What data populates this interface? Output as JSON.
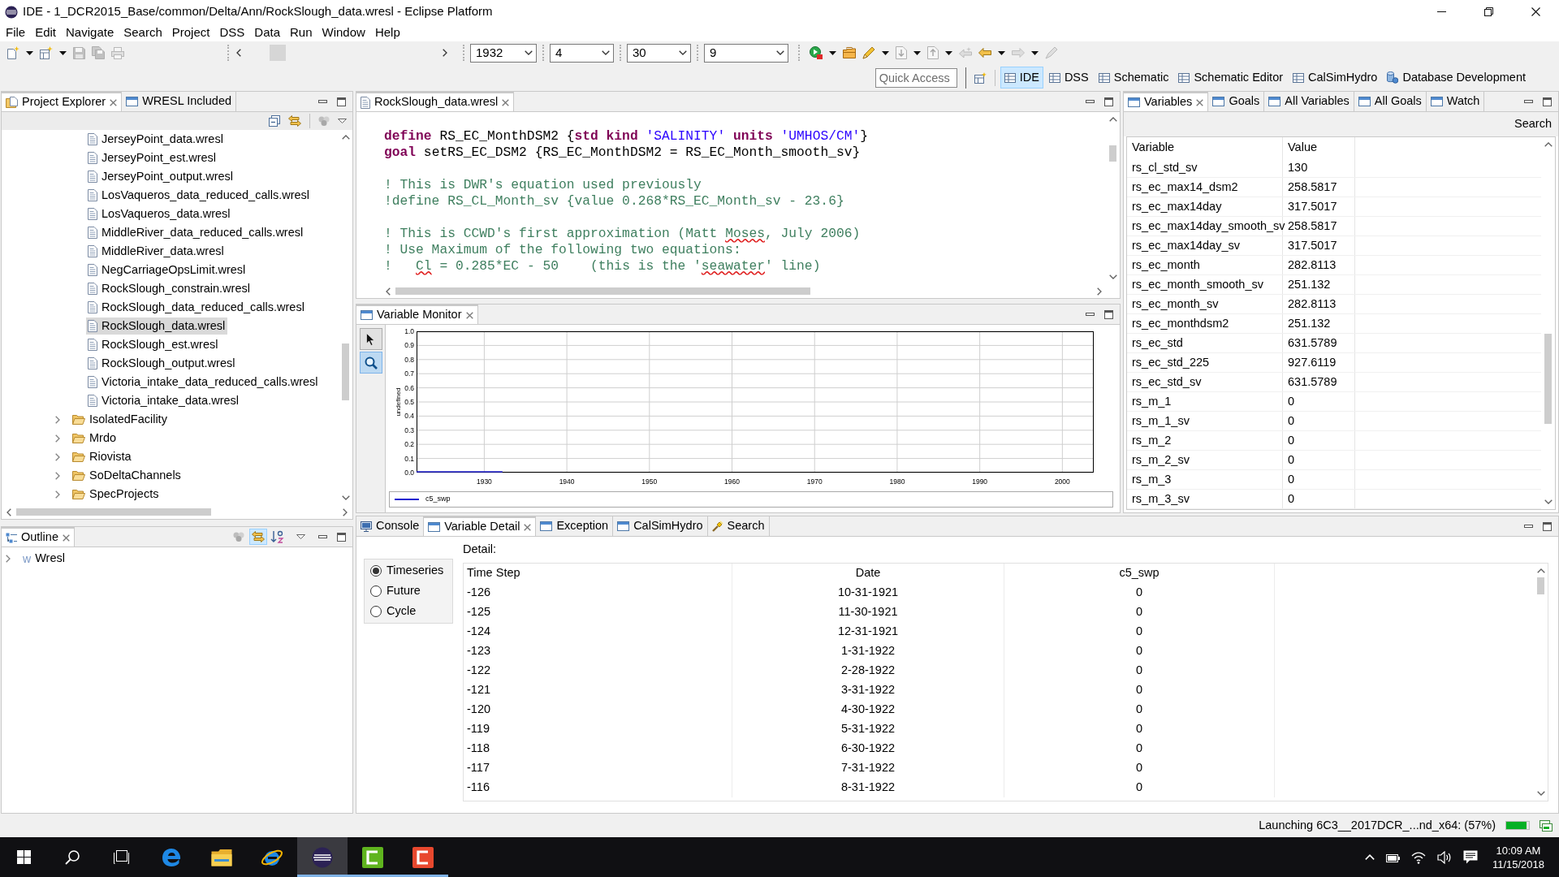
{
  "window": {
    "title": "IDE - 1_DCR2015_Base/common/Delta/Ann/RockSlough_data.wresl - Eclipse Platform"
  },
  "menu": [
    "File",
    "Edit",
    "Navigate",
    "Search",
    "Project",
    "DSS",
    "Data",
    "Run",
    "Window",
    "Help"
  ],
  "toolbar": {
    "tools_left": [
      {
        "kind": "new",
        "dropdown": true,
        "disabled": false
      },
      {
        "kind": "new-window",
        "dropdown": true,
        "disabled": false
      },
      {
        "kind": "save",
        "disabled": true
      },
      {
        "kind": "save-all",
        "disabled": true
      },
      {
        "kind": "print",
        "disabled": true
      }
    ],
    "combos": [
      {
        "value": "1932"
      },
      {
        "value": "4"
      },
      {
        "value": "30"
      },
      {
        "value": "9"
      }
    ],
    "tools_right": [
      {
        "kind": "run",
        "dropdown": true,
        "disabled": false
      },
      {
        "kind": "open",
        "disabled": false
      },
      {
        "kind": "pencil",
        "dropdown": true,
        "disabled": false
      },
      {
        "kind": "annotation-next",
        "dropdown": true,
        "disabled": true
      },
      {
        "kind": "annotation-prev",
        "dropdown": true,
        "disabled": true
      },
      {
        "kind": "last-edit",
        "disabled": true
      },
      {
        "kind": "back",
        "dropdown": true,
        "disabled": false
      },
      {
        "kind": "forward",
        "dropdown": true,
        "disabled": true
      },
      {
        "kind": "pen",
        "disabled": true
      }
    ],
    "quick_access": {
      "placeholder": "Quick Access"
    },
    "perspectives": [
      {
        "label": "IDE",
        "kind": "standard",
        "selected": true
      },
      {
        "label": "DSS",
        "kind": "standard",
        "selected": false
      },
      {
        "label": "Schematic",
        "kind": "standard",
        "selected": false
      },
      {
        "label": "Schematic Editor",
        "kind": "standard",
        "selected": false
      },
      {
        "label": "CalSimHydro",
        "kind": "standard",
        "selected": false
      },
      {
        "label": "Database Development",
        "kind": "database",
        "selected": false
      }
    ]
  },
  "project_explorer": {
    "tabs": [
      {
        "label": "Project Explorer",
        "kind": "explorer",
        "selected": true
      },
      {
        "label": "WRESL Included",
        "kind": "view",
        "selected": false
      }
    ],
    "tree": [
      {
        "children": [
          {
            "label": "JerseyPoint_data.wresl",
            "kind": "file",
            "selected": false
          },
          {
            "label": "JerseyPoint_est.wresl",
            "kind": "file",
            "selected": false
          },
          {
            "label": "JerseyPoint_output.wresl",
            "kind": "file",
            "selected": false
          },
          {
            "label": "LosVaqueros_data_reduced_calls.wresl",
            "kind": "file",
            "selected": false
          },
          {
            "label": "LosVaqueros_data.wresl",
            "kind": "file",
            "selected": false
          },
          {
            "label": "MiddleRiver_data_reduced_calls.wresl",
            "kind": "file",
            "selected": false
          },
          {
            "label": "MiddleRiver_data.wresl",
            "kind": "file",
            "selected": false
          },
          {
            "label": "NegCarriageOpsLimit.wresl",
            "kind": "file",
            "selected": false
          },
          {
            "label": "RockSlough_constrain.wresl",
            "kind": "file",
            "selected": false
          },
          {
            "label": "RockSlough_data_reduced_calls.wresl",
            "kind": "file",
            "selected": false
          },
          {
            "label": "RockSlough_data.wresl",
            "kind": "file",
            "selected": true
          },
          {
            "label": "RockSlough_est.wresl",
            "kind": "file",
            "selected": false
          },
          {
            "label": "RockSlough_output.wresl",
            "kind": "file",
            "selected": false
          },
          {
            "label": "Victoria_intake_data_reduced_calls.wresl",
            "kind": "file",
            "selected": false
          },
          {
            "label": "Victoria_intake_data.wresl",
            "kind": "file",
            "selected": false
          }
        ]
      },
      {
        "label": "IsolatedFacility",
        "kind": "folder",
        "expanded": false,
        "selected": false
      },
      {
        "label": "Mrdo",
        "kind": "folder",
        "expanded": false,
        "selected": false
      },
      {
        "label": "Riovista",
        "kind": "folder",
        "expanded": false,
        "selected": false
      },
      {
        "label": "SoDeltaChannels",
        "kind": "folder",
        "expanded": false,
        "selected": false
      },
      {
        "label": "SpecProjects",
        "kind": "folder",
        "expanded": false,
        "selected": false
      }
    ]
  },
  "outline": {
    "tabs": [
      {
        "label": "Outline",
        "kind": "outline",
        "selected": true
      }
    ],
    "tools": [
      {
        "kind": "filter",
        "on": false
      },
      {
        "kind": "link",
        "on": true
      },
      {
        "kind": "sort",
        "on": false
      }
    ],
    "tree": [
      {
        "icon_letter": "w",
        "label": "Wresl",
        "kind": "element",
        "expanded": false,
        "selected": false
      }
    ]
  },
  "editor": {
    "tabs": [
      {
        "label": "RockSlough_data.wresl",
        "kind": "file",
        "selected": true
      }
    ],
    "blocks": [
      [
        [
          {
            "kind": "keyword",
            "text": "define"
          },
          {
            "kind": "text",
            "text": " RS_EC_MonthDSM2 {"
          },
          {
            "kind": "keyword",
            "text": "std kind"
          },
          {
            "kind": "string",
            "text": " 'SALINITY'"
          },
          {
            "kind": "keyword",
            "text": " units"
          },
          {
            "kind": "string",
            "text": " 'UMHOS/CM'"
          },
          {
            "kind": "text",
            "text": "}"
          }
        ],
        [
          {
            "kind": "keyword",
            "text": "goal"
          },
          {
            "kind": "text",
            "text": " setRS_EC_DSM2 {RS_EC_MonthDSM2 = RS_EC_Month_smooth_sv}"
          }
        ]
      ],
      [
        [
          {
            "kind": "comment",
            "text": "! This is DWR's equation used previously"
          }
        ],
        [
          {
            "kind": "comment",
            "text": "!define RS_CL_Month_sv {value 0.268*RS_EC_Month_sv - 23.6}"
          }
        ]
      ],
      [
        [
          {
            "kind": "comment",
            "text": "! This is CCWD's first approximation (Matt "
          },
          {
            "kind": "typo",
            "text": "Moses"
          },
          {
            "kind": "comment",
            "text": ", July 2006)"
          }
        ],
        [
          {
            "kind": "comment",
            "text": "! Use Maximum of the following two equations:"
          }
        ],
        [
          {
            "kind": "comment",
            "text": "!   "
          },
          {
            "kind": "typo",
            "text": "Cl"
          },
          {
            "kind": "comment",
            "text": " = 0.285*EC - 50    (this is the '"
          },
          {
            "kind": "typo",
            "text": "seawater"
          },
          {
            "kind": "comment",
            "text": "' line)"
          }
        ]
      ]
    ]
  },
  "variable_monitor": {
    "tabs": [
      {
        "label": "Variable Monitor",
        "kind": "view",
        "selected": true
      }
    ],
    "tools": [
      {
        "kind": "pointer",
        "selected": false
      },
      {
        "kind": "zoom",
        "selected": true
      }
    ],
    "chart_data": {
      "type": "line",
      "ylabel": "undefined",
      "x": [
        1921.8,
        1932.2
      ],
      "series": [
        {
          "name": "c5_swp",
          "color": "#2020d0",
          "values": [
            0,
            0
          ]
        }
      ],
      "xlim": [
        1921.8,
        2003.8
      ],
      "ylim": [
        0,
        1
      ],
      "xticks": [
        1930,
        1940,
        1950,
        1960,
        1970,
        1980,
        1990,
        2000
      ],
      "yticks": [
        {
          "value": 0,
          "label": "0.0"
        },
        {
          "value": 0.1,
          "label": "0.1"
        },
        {
          "value": 0.2,
          "label": "0.2"
        },
        {
          "value": 0.3,
          "label": "0.3"
        },
        {
          "value": 0.4,
          "label": "0.4"
        },
        {
          "value": 0.5,
          "label": "0.5"
        },
        {
          "value": 0.6,
          "label": "0.6"
        },
        {
          "value": 0.7,
          "label": "0.7"
        },
        {
          "value": 0.8,
          "label": "0.8"
        },
        {
          "value": 0.9,
          "label": "0.9"
        },
        {
          "value": 1,
          "label": "1.0"
        }
      ],
      "grid": true
    }
  },
  "variables_view": {
    "tabs": [
      {
        "label": "Variables",
        "kind": "view",
        "selected": true
      },
      {
        "label": "Goals",
        "kind": "view",
        "selected": false
      },
      {
        "label": "All Variables",
        "kind": "view",
        "selected": false
      },
      {
        "label": "All Goals",
        "kind": "view",
        "selected": false
      },
      {
        "label": "Watch",
        "kind": "view",
        "selected": false
      }
    ],
    "search_button": "Search",
    "table": {
      "columns": [
        "Variable",
        "Value"
      ],
      "rows": [
        [
          "rs_cl_std_sv",
          "130"
        ],
        [
          "rs_ec_max14_dsm2",
          "258.5817"
        ],
        [
          "rs_ec_max14day",
          "317.5017"
        ],
        [
          "rs_ec_max14day_smooth_sv",
          "258.5817"
        ],
        [
          "rs_ec_max14day_sv",
          "317.5017"
        ],
        [
          "rs_ec_month",
          "282.8113"
        ],
        [
          "rs_ec_month_smooth_sv",
          "251.132"
        ],
        [
          "rs_ec_month_sv",
          "282.8113"
        ],
        [
          "rs_ec_monthdsm2",
          "251.132"
        ],
        [
          "rs_ec_std",
          "631.5789"
        ],
        [
          "rs_ec_std_225",
          "927.6119"
        ],
        [
          "rs_ec_std_sv",
          "631.5789"
        ],
        [
          "rs_m_1",
          "0"
        ],
        [
          "rs_m_1_sv",
          "0"
        ],
        [
          "rs_m_2",
          "0"
        ],
        [
          "rs_m_2_sv",
          "0"
        ],
        [
          "rs_m_3",
          "0"
        ],
        [
          "rs_m_3_sv",
          "0"
        ]
      ]
    }
  },
  "detail_view": {
    "tabs": [
      {
        "label": "Console",
        "kind": "console",
        "selected": false
      },
      {
        "label": "Variable Detail",
        "kind": "view",
        "selected": true
      },
      {
        "label": "Exception",
        "kind": "view",
        "selected": false
      },
      {
        "label": "CalSimHydro",
        "kind": "view",
        "selected": false
      },
      {
        "label": "Search",
        "kind": "search",
        "selected": false
      }
    ],
    "detail_label": "Detail:",
    "modes": [
      {
        "label": "Timeseries",
        "selected": true
      },
      {
        "label": "Future",
        "selected": false
      },
      {
        "label": "Cycle",
        "selected": false
      }
    ],
    "table": {
      "columns": [
        "Time Step",
        "Date",
        "c5_swp"
      ],
      "rows": [
        [
          "-126",
          "10-31-1921",
          "0"
        ],
        [
          "-125",
          "11-30-1921",
          "0"
        ],
        [
          "-124",
          "12-31-1921",
          "0"
        ],
        [
          "-123",
          "1-31-1922",
          "0"
        ],
        [
          "-122",
          "2-28-1922",
          "0"
        ],
        [
          "-121",
          "3-31-1922",
          "0"
        ],
        [
          "-120",
          "4-30-1922",
          "0"
        ],
        [
          "-119",
          "5-31-1922",
          "0"
        ],
        [
          "-118",
          "6-30-1922",
          "0"
        ],
        [
          "-117",
          "7-31-1922",
          "0"
        ],
        [
          "-116",
          "8-31-1922",
          "0"
        ]
      ]
    }
  },
  "status_bar": {
    "message": "Launching 6C3__2017DCR_...nd_x64: (57%)",
    "level": 0.9
  },
  "taskbar": {
    "apps": [
      {
        "kind": "browser-e",
        "running": false,
        "selected": false
      },
      {
        "kind": "files",
        "running": false,
        "selected": false
      },
      {
        "kind": "browser-ie",
        "running": false,
        "selected": false
      },
      {
        "kind": "eclipse",
        "running": true,
        "selected": true
      },
      {
        "kind": "tile-green",
        "running": true,
        "selected": false
      },
      {
        "kind": "tile-red",
        "running": true,
        "selected": false
      }
    ],
    "time": "10:09 AM",
    "date": "11/15/2018"
  }
}
